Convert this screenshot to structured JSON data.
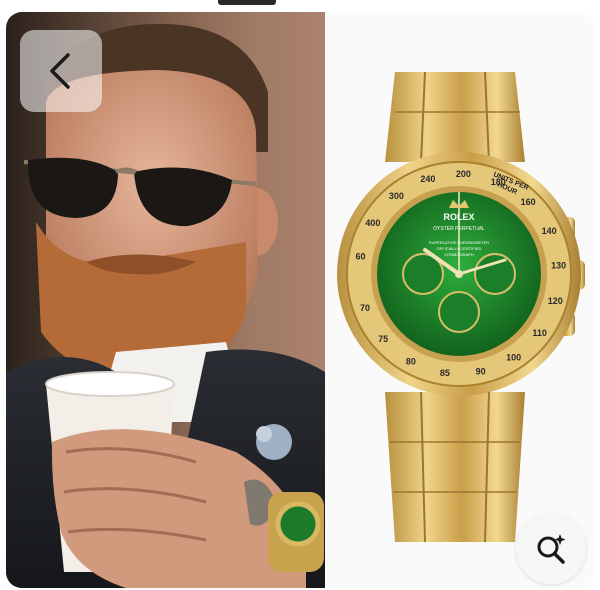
{
  "toolbar": {
    "back_icon": "chevron-left-icon",
    "visual_search_icon": "sparkle-search-icon"
  },
  "photo_left": {
    "subject": "man-with-coffee-cup"
  },
  "watch": {
    "brand": "ROLEX",
    "line1": "OYSTER PERPETUAL",
    "line2": "SUPERLATIVE CHRONOMETER",
    "line3": "OFFICIALLY CERTIFIED",
    "line4": "COSMOGRAPH",
    "bezel_top": "UNITS PER",
    "bezel_top2": "HOUR",
    "bezel_numbers": [
      "60",
      "400",
      "300",
      "240",
      "200",
      "180",
      "160",
      "140",
      "130",
      "120",
      "110",
      "100",
      "90",
      "85",
      "80",
      "75",
      "70"
    ],
    "dial_color": "#1f8a2a",
    "case_color": "#d9b45a"
  }
}
